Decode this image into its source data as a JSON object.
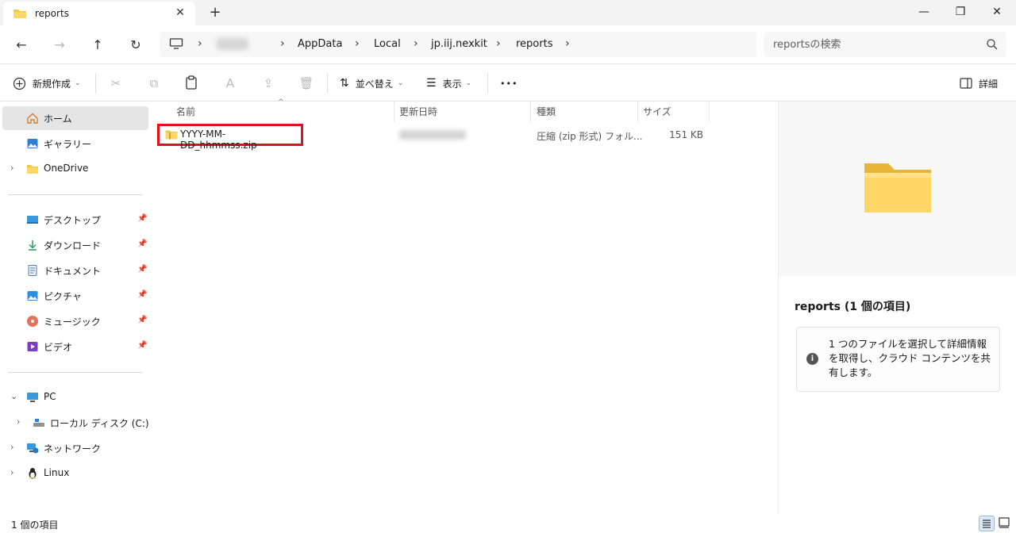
{
  "window": {
    "tab_title": "reports",
    "close_tab_glyph": "✕",
    "new_tab_glyph": "+",
    "minimize_glyph": "—",
    "maximize_glyph": "❐",
    "close_glyph": "✕"
  },
  "nav": {
    "back_glyph": "←",
    "forward_glyph": "→",
    "up_glyph": "↑",
    "refresh_glyph": "↻",
    "breadcrumb": [
      "████",
      "AppData",
      "Local",
      "jp.iij.nexkit",
      "reports"
    ],
    "breadcrumb_sep": "›",
    "search_placeholder": "reportsの検索"
  },
  "commands": {
    "new_label": "新規作成",
    "sort_label": "並べ替え",
    "view_label": "表示",
    "more_label": "•••",
    "details_label": "詳細",
    "cut_glyph": "✂",
    "copy_glyph": "⧉",
    "paste_glyph": "📋",
    "rename_glyph": "A",
    "share_glyph": "⇪",
    "delete_glyph": "🗑"
  },
  "sidebar": {
    "home": "ホーム",
    "gallery": "ギャラリー",
    "onedrive": "OneDrive",
    "pinned": [
      {
        "label": "デスクトップ",
        "icon": "desktop-icon"
      },
      {
        "label": "ダウンロード",
        "icon": "download-icon"
      },
      {
        "label": "ドキュメント",
        "icon": "document-icon"
      },
      {
        "label": "ピクチャ",
        "icon": "pictures-icon"
      },
      {
        "label": "ミュージック",
        "icon": "music-icon"
      },
      {
        "label": "ビデオ",
        "icon": "video-icon"
      }
    ],
    "pc": "PC",
    "local_disk": "ローカル ディスク (C:)",
    "network": "ネットワーク",
    "linux": "Linux",
    "pin_glyph": "📌",
    "chev_right": "›",
    "chev_down": "⌄"
  },
  "columns": {
    "name": "名前",
    "modified": "更新日時",
    "type": "種類",
    "size": "サイズ",
    "sort_glyph": "^"
  },
  "files": [
    {
      "name": "YYYY-MM-DD_hhmmss.zip",
      "modified": "████/██/██ ██:██",
      "type": "圧縮 (zip 形式) フォル...",
      "size": "151 KB"
    }
  ],
  "details": {
    "title": "reports (1 個の項目)",
    "info_glyph": "i",
    "info_text": "1 つのファイルを選択して詳細情報を取得し、クラウド コンテンツを共有します。"
  },
  "status": {
    "count": "1 個の項目"
  },
  "colors": {
    "highlight_border": "#e5101b",
    "folder_yellow": "#f4c542",
    "selected_bg": "#e5e5e5"
  }
}
